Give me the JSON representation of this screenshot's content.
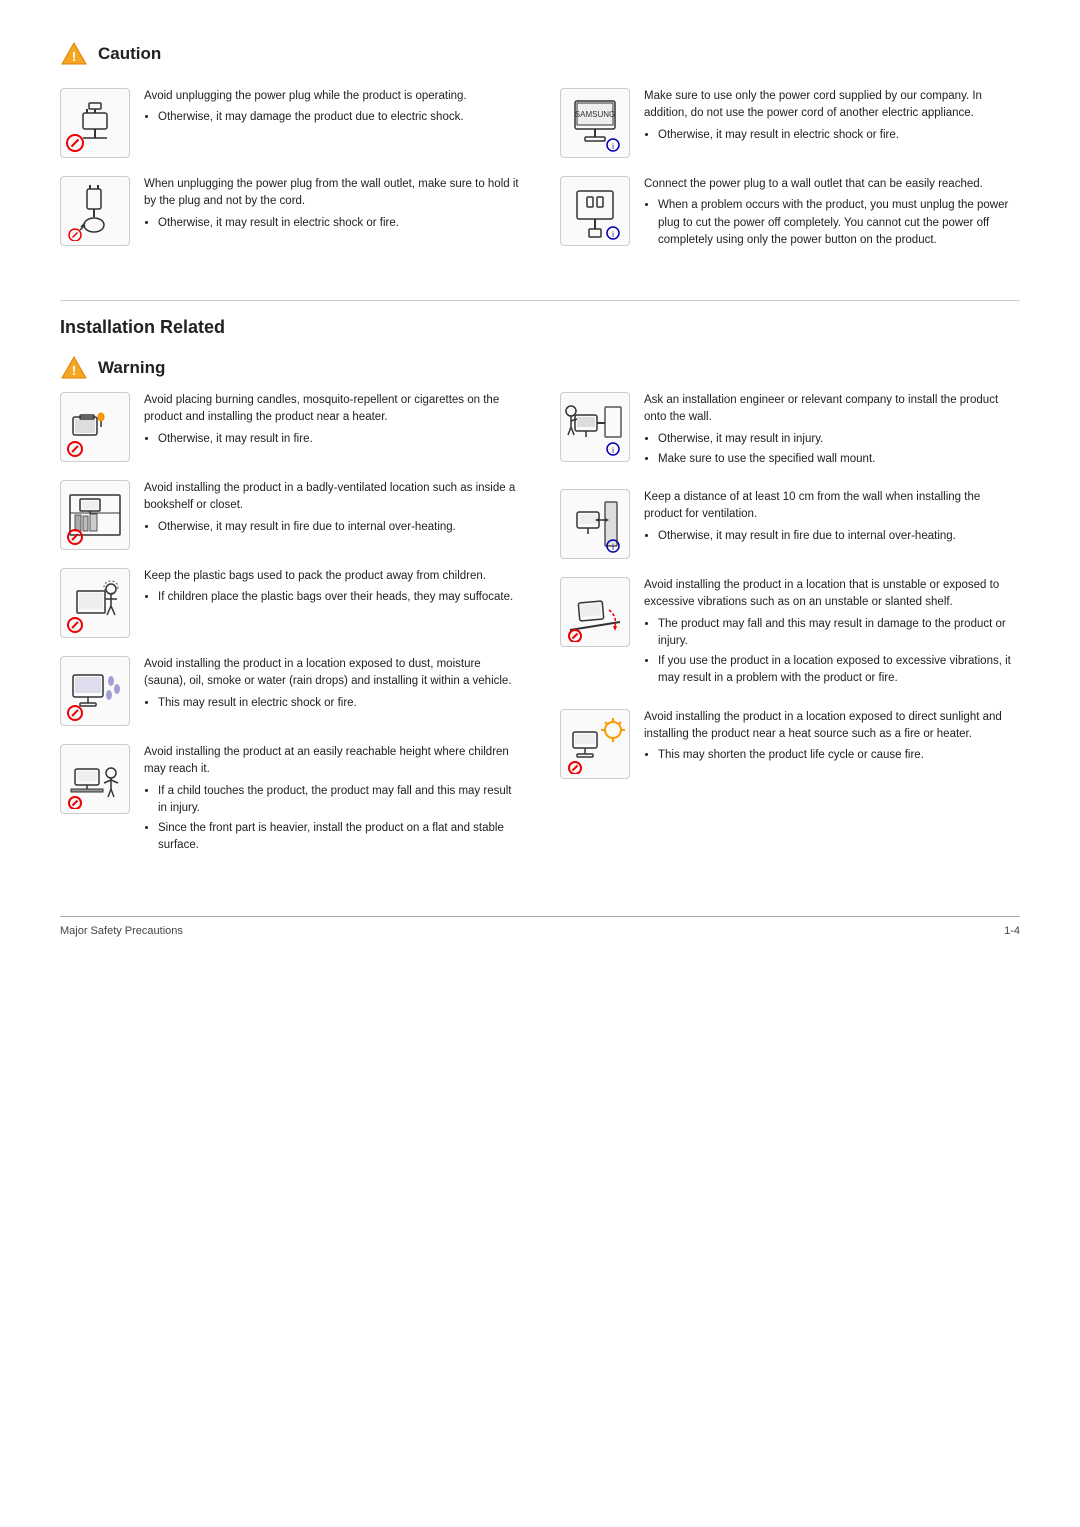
{
  "caution": {
    "title": "Caution",
    "items_left": [
      {
        "id": "caution-1",
        "main_text": "Avoid unplugging the power plug while the product is operating.",
        "bullets": [
          "Otherwise, it may damage the product due to electric shock."
        ]
      },
      {
        "id": "caution-2",
        "main_text": "When unplugging the power plug from the wall outlet, make sure to hold it by the plug and not by the cord.",
        "bullets": [
          "Otherwise, it may result in electric shock or fire."
        ]
      }
    ],
    "items_right": [
      {
        "id": "caution-3",
        "main_text": "Make sure to use only the power cord supplied by our company. In addition, do not use the power cord of another electric appliance.",
        "bullets": [
          "Otherwise, it may result in electric shock or fire."
        ]
      },
      {
        "id": "caution-4",
        "main_text": "Connect the power plug to a wall outlet that can be easily reached.",
        "bullets": [
          "When a problem occurs with the product, you must unplug the power plug to cut the power off completely. You cannot cut the power off completely using only the power button on the product."
        ]
      }
    ]
  },
  "installation": {
    "title": "Installation Related",
    "warning_title": "Warning",
    "items_left": [
      {
        "id": "warn-1",
        "main_text": "Avoid placing burning candles,  mosquito-repellent or cigarettes on the product and installing the product near a heater.",
        "bullets": [
          "Otherwise, it may result in fire."
        ]
      },
      {
        "id": "warn-2",
        "main_text": "Avoid installing the product in a badly-ventilated location such as inside a bookshelf or closet.",
        "bullets": [
          "Otherwise, it may result in fire due to internal over-heating."
        ]
      },
      {
        "id": "warn-3",
        "main_text": "Keep the plastic bags used to pack the product away from children.",
        "bullets": [
          "If children place the plastic bags over their heads, they may suffocate."
        ]
      },
      {
        "id": "warn-4",
        "main_text": "Avoid installing the product in a location exposed to dust, moisture (sauna), oil, smoke or water (rain drops) and installing it within a vehicle.",
        "bullets": [
          "This may result in electric shock or fire."
        ]
      },
      {
        "id": "warn-5",
        "main_text": "Avoid installing the product at an easily reachable height where children may reach it.",
        "bullets": [
          "If a child touches the product, the product may fall and this may result in injury.",
          "Since the front part is heavier, install the product on a flat and stable surface."
        ]
      }
    ],
    "items_right": [
      {
        "id": "warn-r1",
        "main_text": "Ask an installation engineer or relevant company to install the product onto the wall.",
        "bullets": [
          "Otherwise, it may result in injury.",
          "Make sure to use the specified wall mount."
        ]
      },
      {
        "id": "warn-r2",
        "main_text": "Keep a distance of at least 10 cm from the wall when installing the product for ventilation.",
        "bullets": [
          "Otherwise, it may result in fire due to internal over-heating."
        ]
      },
      {
        "id": "warn-r3",
        "main_text": "Avoid installing the product in a location that is unstable or exposed to excessive vibrations such as on an unstable or slanted shelf.",
        "bullets": [
          "The product may fall and this may result in damage to the product or injury.",
          "If you use the product in a location exposed to excessive vibrations, it may result in a problem with the product or fire."
        ]
      },
      {
        "id": "warn-r4",
        "main_text": "Avoid installing the product in a location exposed to direct sunlight and installing the product near a heat source such as a fire or heater.",
        "bullets": [
          "This may shorten the product life cycle or cause fire."
        ]
      }
    ]
  },
  "footer": {
    "left": "Major Safety Precautions",
    "right": "1-4"
  }
}
